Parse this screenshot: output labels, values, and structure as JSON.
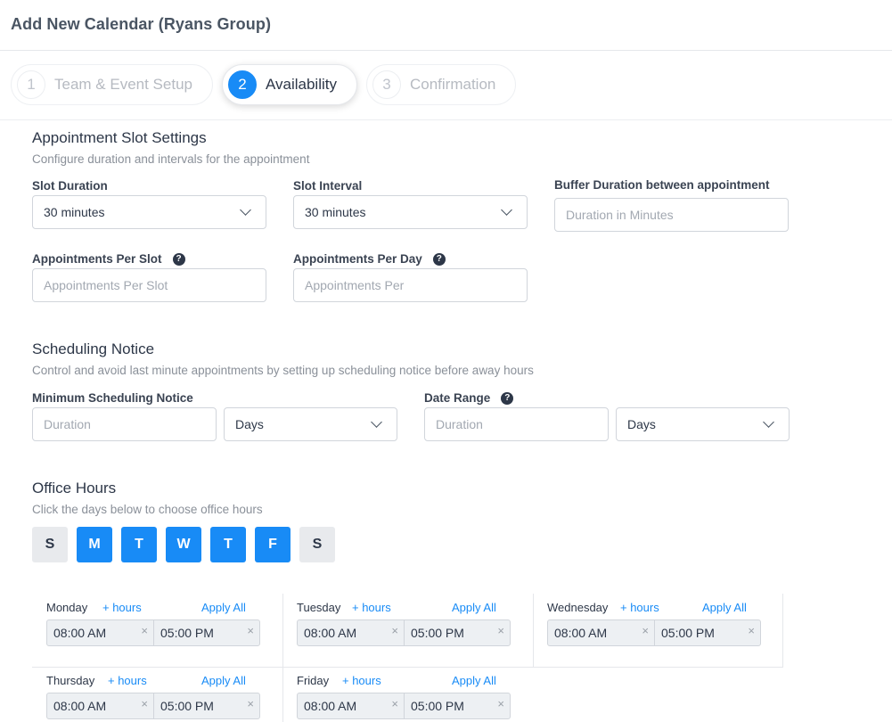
{
  "page_title": "Add New Calendar (Ryans Group)",
  "steps": [
    {
      "num": "1",
      "label": "Team & Event Setup"
    },
    {
      "num": "2",
      "label": "Availability"
    },
    {
      "num": "3",
      "label": "Confirmation"
    }
  ],
  "slot_settings": {
    "title": "Appointment Slot Settings",
    "subtitle": "Configure duration and intervals for the appointment",
    "slot_duration_label": "Slot Duration",
    "slot_duration_value": "30 minutes",
    "slot_interval_label": "Slot Interval",
    "slot_interval_value": "30 minutes",
    "buffer_label": "Buffer Duration between appointment",
    "buffer_placeholder": "Duration in Minutes",
    "per_slot_label": "Appointments Per Slot",
    "per_slot_placeholder": "Appointments Per Slot",
    "per_day_label": "Appointments Per Day",
    "per_day_placeholder": "Appointments Per"
  },
  "scheduling": {
    "title": "Scheduling Notice",
    "subtitle": "Control and avoid last minute appointments by setting up scheduling notice before away hours",
    "min_notice_label": "Minimum Scheduling Notice",
    "min_notice_placeholder": "Duration",
    "min_notice_unit": "Days",
    "date_range_label": "Date Range",
    "date_range_placeholder": "Duration",
    "date_range_unit": "Days"
  },
  "office_hours": {
    "title": "Office Hours",
    "subtitle": "Click the days below to choose office hours",
    "days": [
      {
        "letter": "S",
        "selected": false
      },
      {
        "letter": "M",
        "selected": true
      },
      {
        "letter": "T",
        "selected": true
      },
      {
        "letter": "W",
        "selected": true
      },
      {
        "letter": "T",
        "selected": true
      },
      {
        "letter": "F",
        "selected": true
      },
      {
        "letter": "S",
        "selected": false
      }
    ],
    "add_hours_label": "+ hours",
    "apply_all_label": "Apply All",
    "schedule": [
      {
        "day": "Monday",
        "start": "08:00 AM",
        "end": "05:00 PM"
      },
      {
        "day": "Tuesday",
        "start": "08:00 AM",
        "end": "05:00 PM"
      },
      {
        "day": "Wednesday",
        "start": "08:00 AM",
        "end": "05:00 PM"
      },
      {
        "day": "Thursday",
        "start": "08:00 AM",
        "end": "05:00 PM"
      },
      {
        "day": "Friday",
        "start": "08:00 AM",
        "end": "05:00 PM"
      }
    ],
    "clear_glyph": "×"
  },
  "help_glyph": "?",
  "colors": {
    "accent": "#188bf6",
    "day_off": "#e8eaed",
    "time_bg": "#edf0f3"
  }
}
